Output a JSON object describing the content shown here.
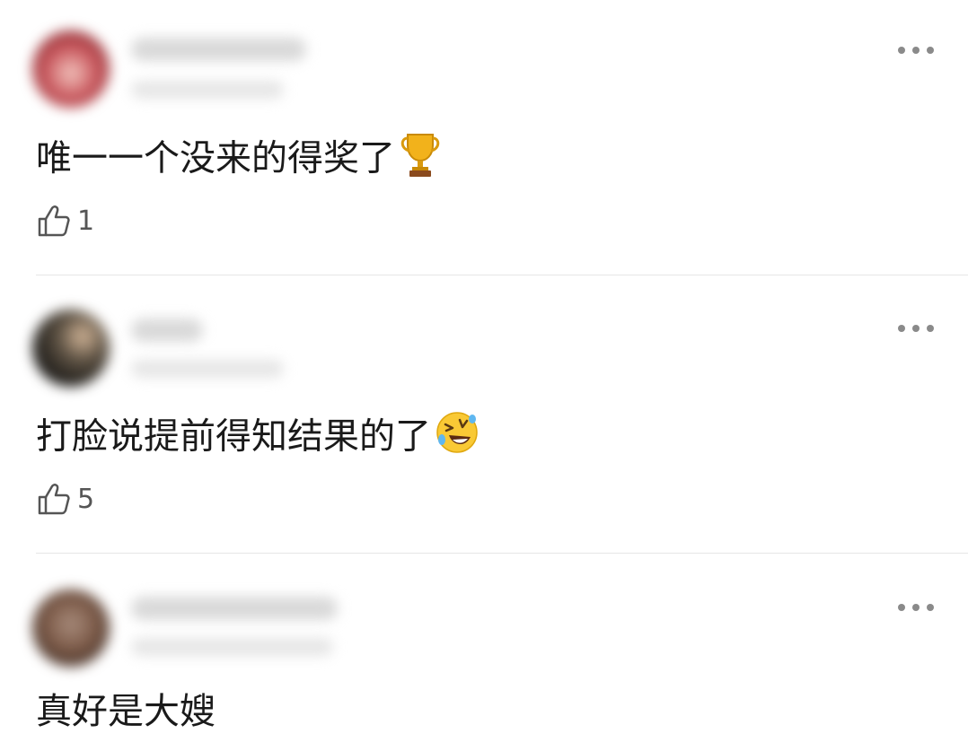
{
  "comments": [
    {
      "text": "唯一一个没来的得奖了",
      "emoji": "trophy-icon",
      "likes": "1"
    },
    {
      "text": "打脸说提前得知结果的了",
      "emoji": "rofl-emoji-icon",
      "likes": "5"
    },
    {
      "text": "真好是大嫂"
    }
  ],
  "colors": {
    "divider": "#e6e6e6",
    "icon": "#555555",
    "text": "#1a1a1a"
  }
}
